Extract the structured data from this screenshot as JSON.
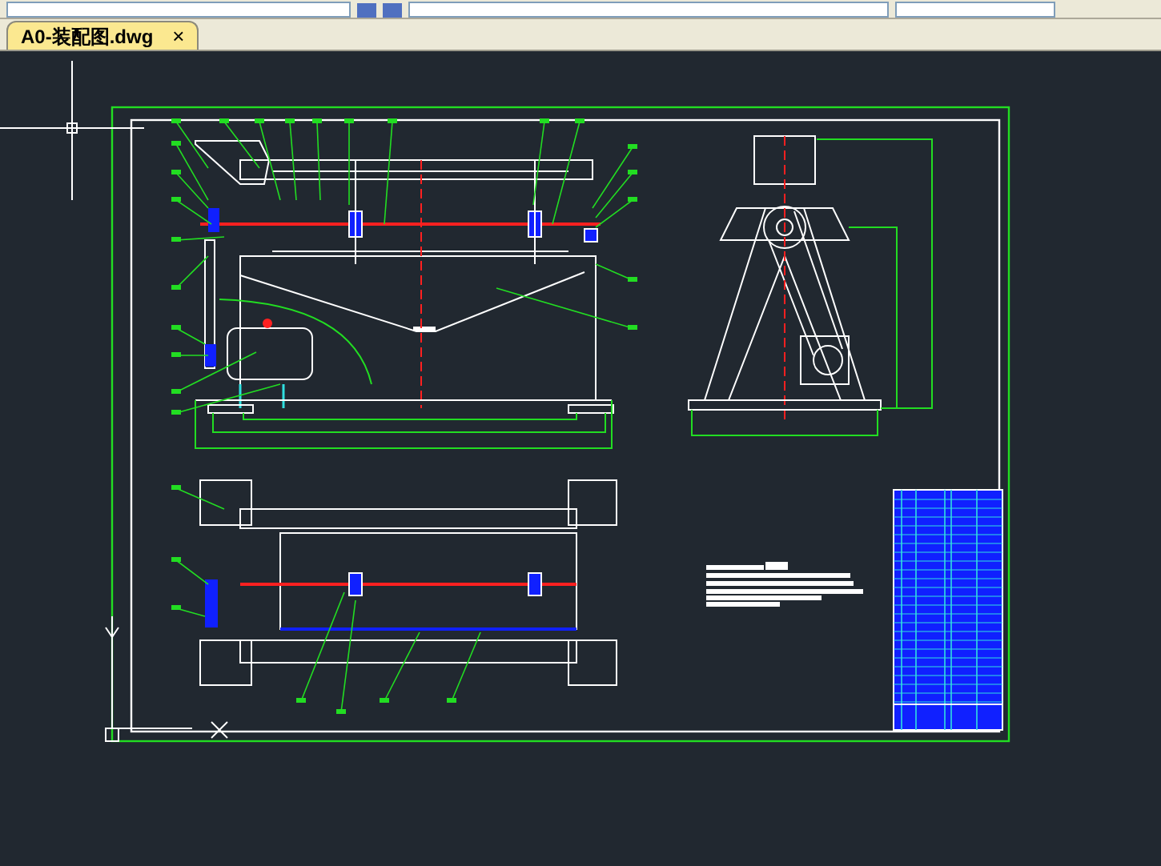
{
  "tabs": [
    {
      "label": "A0-装配图.dwg",
      "close": "×",
      "selected": true
    }
  ]
}
